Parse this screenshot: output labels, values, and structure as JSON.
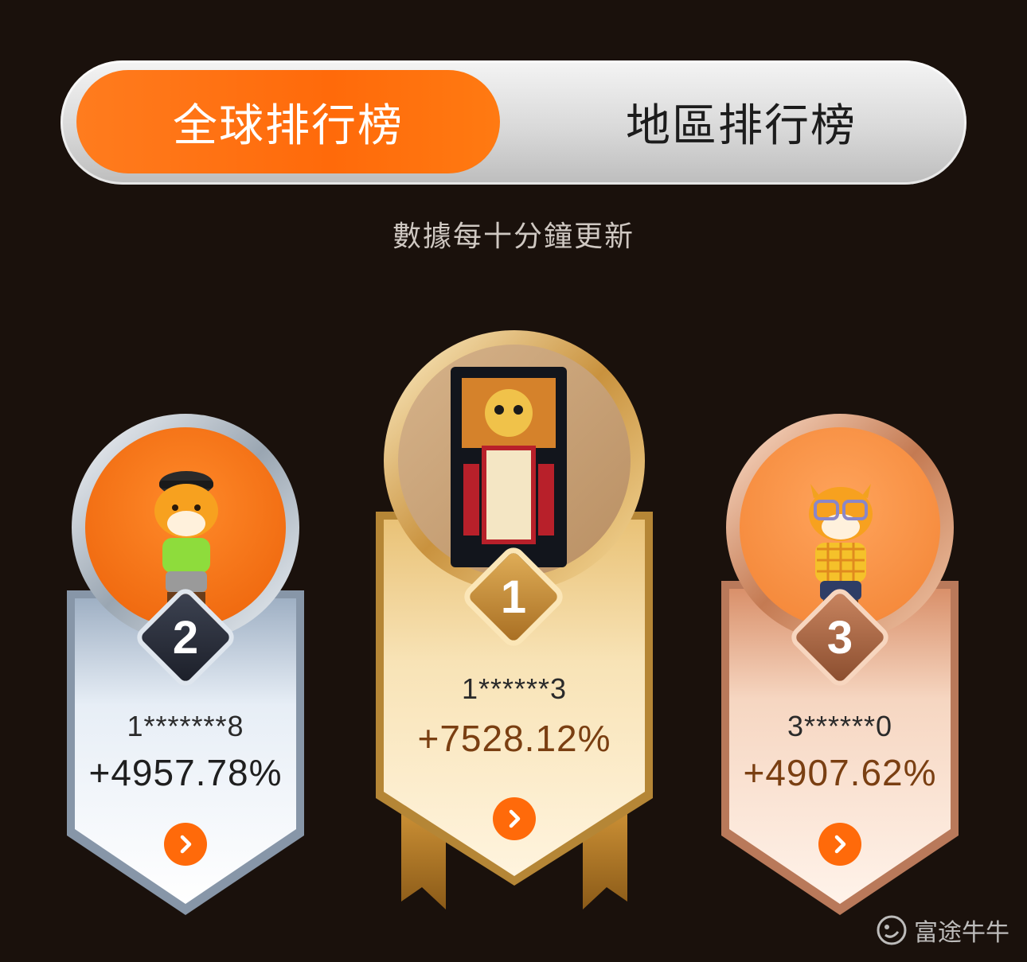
{
  "tabs": {
    "global_label": "全球排行榜",
    "region_label": "地區排行榜",
    "active": "global"
  },
  "update_note": "數據每十分鐘更新",
  "podium": {
    "first": {
      "rank": "1",
      "user_id": "1******3",
      "gain": "+7528.12%"
    },
    "second": {
      "rank": "2",
      "user_id": "1*******8",
      "gain": "+4957.78%"
    },
    "third": {
      "rank": "3",
      "user_id": "3******0",
      "gain": "+4907.62%"
    }
  },
  "colors": {
    "accent": "#ff6a0a",
    "gold": "#d9a84e",
    "silver": "#b9c3cf",
    "bronze": "#d99a78",
    "background": "#1a110c"
  },
  "icons": {
    "go": "chevron-right-icon",
    "watermark": "futu-logo-icon"
  },
  "watermark": "富途牛牛"
}
